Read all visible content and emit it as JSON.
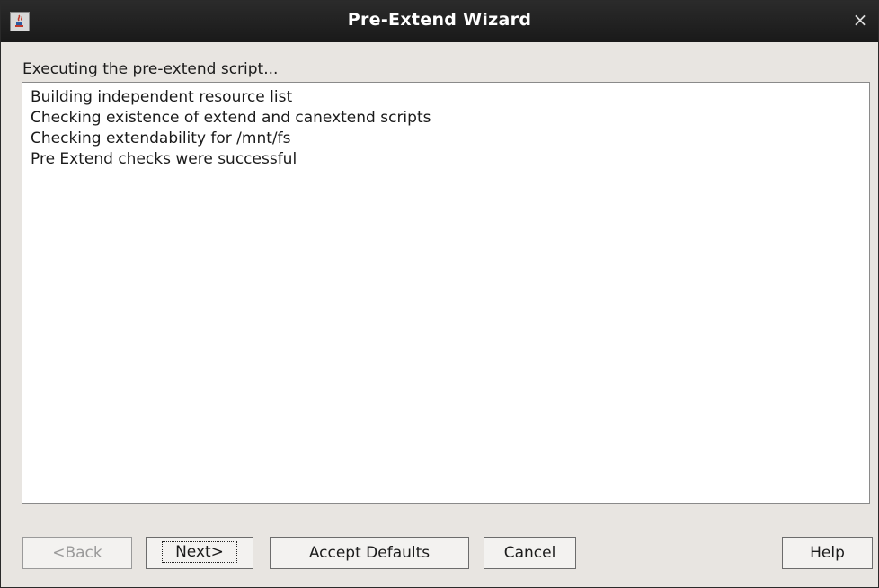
{
  "window": {
    "title": "Pre-Extend Wizard",
    "close_glyph": "×",
    "app_icon": "java-coffee-icon"
  },
  "status_label": "Executing the pre-extend script...",
  "log_lines": [
    "Building independent resource list",
    "Checking existence of extend and canextend scripts",
    "Checking extendability for /mnt/fs",
    "Pre Extend checks were successful"
  ],
  "buttons": {
    "back": "<Back",
    "next": "Next>",
    "accept_defaults": "Accept Defaults",
    "cancel": "Cancel",
    "help": "Help"
  }
}
